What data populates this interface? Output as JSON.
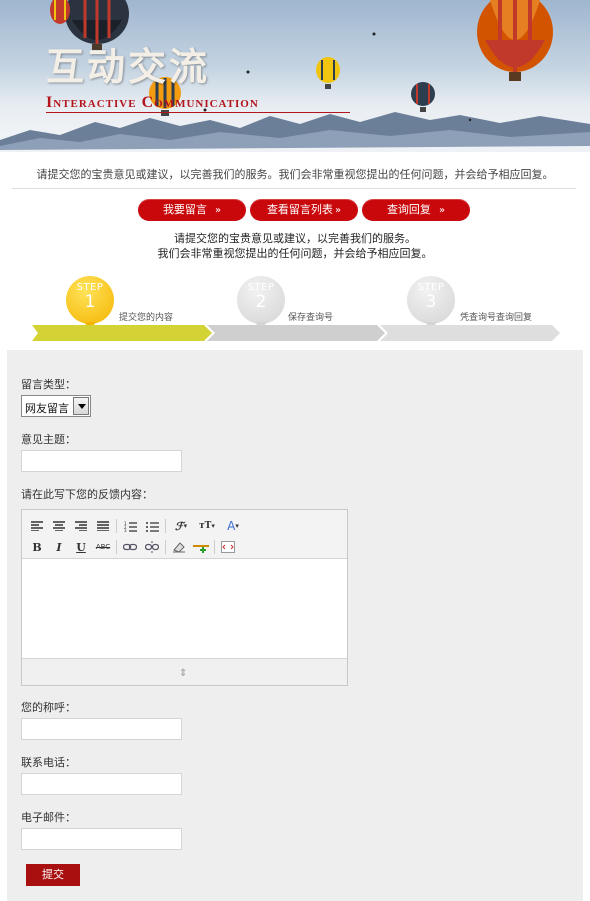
{
  "banner": {
    "title": "互动交流",
    "subtitle": "Interactive Communication"
  },
  "intro_text": "请提交您的宝贵意见或建议，以完善我们的服务。我们会非常重视您提出的任何问题，并会给予相应回复。",
  "buttons": [
    {
      "label": "我要留言",
      "arrow": "»"
    },
    {
      "label": "查看留言列表",
      "arrow": "»"
    },
    {
      "label": "查询回复",
      "arrow": "»"
    }
  ],
  "notice": {
    "line1": "请提交您的宝贵意见或建议，以完善我们的服务。",
    "line2": "我们会非常重视您提出的任何问题，并会给予相应回复。"
  },
  "steps": [
    {
      "tag": "STEP",
      "num": "1",
      "label": "提交您的内容",
      "active": true
    },
    {
      "tag": "STEP",
      "num": "2",
      "label": "保存查询号",
      "active": false
    },
    {
      "tag": "STEP",
      "num": "3",
      "label": "凭查询号查询回复",
      "active": false
    }
  ],
  "form": {
    "type_label": "留言类型：",
    "type_value": "网友留言",
    "subject_label": "意见主题：",
    "subject_value": "",
    "content_label": "请在此写下您的反馈内容：",
    "name_label": "您的称呼：",
    "name_value": "",
    "phone_label": "联系电话：",
    "phone_value": "",
    "email_label": "电子邮件：",
    "email_value": "",
    "submit_label": "提交"
  },
  "colors": {
    "accent_red": "#c9080c",
    "step_active": "#d4d336",
    "step_inactive": "#cfcfcf"
  }
}
